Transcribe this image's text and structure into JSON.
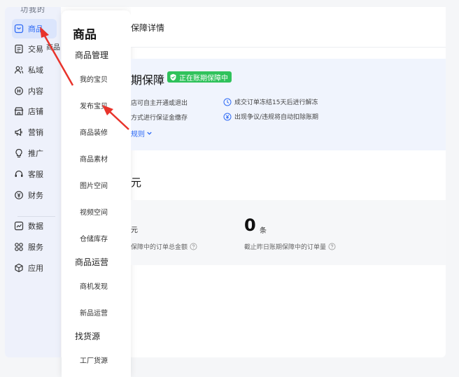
{
  "nav": {
    "top_cut_text": "功我的",
    "tooltip": "商品",
    "items": [
      {
        "label": "商品",
        "icon": "bag-icon",
        "active": true
      },
      {
        "label": "交易",
        "icon": "order-icon"
      },
      {
        "label": "私域",
        "icon": "users-icon"
      },
      {
        "label": "内容",
        "icon": "content-icon"
      },
      {
        "label": "店铺",
        "icon": "store-icon"
      },
      {
        "label": "营销",
        "icon": "megaphone-icon"
      },
      {
        "label": "推广",
        "icon": "bulb-icon"
      },
      {
        "label": "客服",
        "icon": "headset-icon"
      },
      {
        "label": "财务",
        "icon": "finance-icon"
      },
      {
        "label": "数据",
        "icon": "chart-icon"
      },
      {
        "label": "服务",
        "icon": "grid-icon"
      },
      {
        "label": "应用",
        "icon": "cube-icon"
      }
    ]
  },
  "submenu": {
    "title": "商品",
    "groups": [
      {
        "label": "商品管理",
        "items": [
          "我的宝贝",
          "发布宝贝",
          "商品装修",
          "商品素材",
          "图片空间",
          "视频空间",
          "仓储库存"
        ]
      },
      {
        "label": "商品运营",
        "items": [
          "商机发现",
          "新品运营"
        ]
      },
      {
        "label": "找货源",
        "items": [
          "工厂货源"
        ]
      }
    ]
  },
  "header": {
    "title": "保障详情"
  },
  "guarantee": {
    "title": "期保障",
    "badge": "正在账期保障中",
    "benefits": [
      "店可自主开通或退出",
      "成交订单冻结15天后进行解冻",
      "方式进行保证金缴存",
      "出现争议/违规将自动扣除账期"
    ],
    "rules_link": "规则"
  },
  "deposit": {
    "unit": "元"
  },
  "stats": {
    "left_unit": "元",
    "left_label": "保障中的订单总金额",
    "right_value": "0",
    "right_unit": "条",
    "right_label": "截止昨日账期保障中的订单量"
  },
  "colors": {
    "accent": "#2f6bf5",
    "badge_green": "#2fc25b",
    "arrow_red": "#e8332b"
  }
}
